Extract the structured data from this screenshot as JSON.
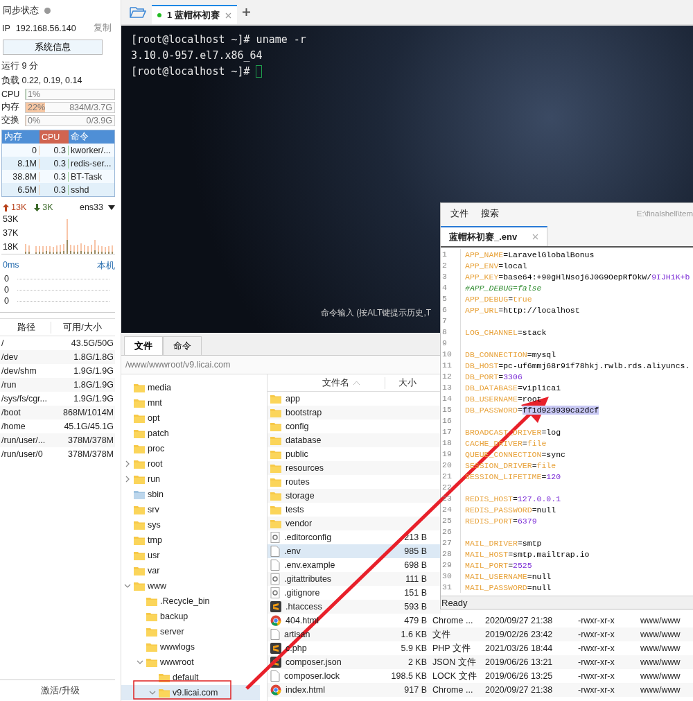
{
  "sidebar": {
    "sync_label": "同步状态",
    "ip_label": "IP",
    "ip": "192.168.56.140",
    "copy_link": "复制",
    "sysinfo_button": "系统信息",
    "uptime": "运行 9 分",
    "load": "负载 0.22, 0.19, 0.14",
    "meters": [
      {
        "label": "CPU",
        "percent": "1%",
        "level": 0.01
      },
      {
        "label": "内存",
        "percent": "22%",
        "detail": "834M/3.7G",
        "level": 0.22
      },
      {
        "label": "交换",
        "percent": "0%",
        "detail": "0/3.9G",
        "level": 0
      }
    ],
    "process_table": {
      "columns": [
        "内存",
        "CPU",
        "命令"
      ],
      "rows": [
        [
          "0",
          "0.3",
          "kworker/..."
        ],
        [
          "8.1M",
          "0.3",
          "redis-ser..."
        ],
        [
          "38.8M",
          "0.3",
          "BT-Task"
        ],
        [
          "6.5M",
          "0.3",
          "sshd"
        ]
      ]
    },
    "network": {
      "up": "13K",
      "down": "3K",
      "interface": "ens33",
      "ticks": [
        "53K",
        "37K",
        "18K"
      ]
    },
    "latency": {
      "reading": "0ms",
      "host": "本机",
      "ticks": [
        "0",
        "0",
        "0"
      ]
    },
    "disk_table": {
      "columns": [
        "路径",
        "可用/大小"
      ],
      "rows": [
        [
          "/",
          "43.5G/50G"
        ],
        [
          "/dev",
          "1.8G/1.8G"
        ],
        [
          "/dev/shm",
          "1.9G/1.9G"
        ],
        [
          "/run",
          "1.8G/1.9G"
        ],
        [
          "/sys/fs/cgr...",
          "1.9G/1.9G"
        ],
        [
          "/boot",
          "868M/1014M"
        ],
        [
          "/home",
          "45.1G/45.1G"
        ],
        [
          "/run/user/...",
          "378M/378M"
        ],
        [
          "/run/user/0",
          "378M/378M"
        ]
      ]
    },
    "upgrade_link": "激活/升级"
  },
  "session_tabs": [
    {
      "number": "1",
      "title": "蓝帽杯初赛",
      "selected": true,
      "connected": true
    }
  ],
  "terminal": {
    "lines": [
      "[root@localhost ~]# uname -r",
      "3.10.0-957.el7.x86_64",
      "[root@localhost ~]#"
    ],
    "input_hint": "命令输入 (按ALT键提示历史,T"
  },
  "bottom_tabs": [
    {
      "label": "文件",
      "selected": true
    },
    {
      "label": "命令",
      "selected": false
    }
  ],
  "path": "/www/wwwroot/v9.licai.com",
  "tree": [
    {
      "label": "media",
      "kind": "folder",
      "selected": false
    },
    {
      "label": "mnt",
      "kind": "folder",
      "selected": false
    },
    {
      "label": "opt",
      "kind": "folder",
      "selected": false
    },
    {
      "label": "patch",
      "kind": "folder",
      "selected": false
    },
    {
      "label": "proc",
      "kind": "folder",
      "selected": false
    },
    {
      "label": "root",
      "kind": "folder",
      "expanded": false,
      "selected": false
    },
    {
      "label": "run",
      "kind": "folder",
      "expanded": false,
      "selected": false
    },
    {
      "label": "sbin",
      "kind": "link",
      "selected": false
    },
    {
      "label": "srv",
      "kind": "folder",
      "selected": false
    },
    {
      "label": "sys",
      "kind": "folder",
      "selected": false
    },
    {
      "label": "tmp",
      "kind": "folder",
      "selected": false
    },
    {
      "label": "usr",
      "kind": "folder",
      "selected": false
    },
    {
      "label": "var",
      "kind": "folder",
      "selected": false
    },
    {
      "label": "www",
      "kind": "folder",
      "expanded": true,
      "selected": false,
      "children": [
        {
          "label": ".Recycle_bin",
          "kind": "folder",
          "selected": false
        },
        {
          "label": "backup",
          "kind": "folder",
          "selected": false
        },
        {
          "label": "server",
          "kind": "folder",
          "selected": false
        },
        {
          "label": "wwwlogs",
          "kind": "folder",
          "selected": false
        },
        {
          "label": "wwwroot",
          "kind": "folder",
          "expanded": true,
          "selected": false,
          "children": [
            {
              "label": "default",
              "kind": "folder",
              "selected": false
            },
            {
              "label": "v9.licai.com",
              "kind": "folder",
              "expanded": true,
              "selected": true
            }
          ]
        }
      ]
    }
  ],
  "file_table": {
    "columns": [
      "文件名",
      "大小"
    ],
    "rows": [
      {
        "name": "app",
        "kind": "folder",
        "selected": false
      },
      {
        "name": "bootstrap",
        "kind": "folder",
        "selected": false
      },
      {
        "name": "config",
        "kind": "folder",
        "selected": false
      },
      {
        "name": "database",
        "kind": "folder",
        "selected": false
      },
      {
        "name": "public",
        "kind": "folder",
        "selected": false
      },
      {
        "name": "resources",
        "kind": "folder",
        "selected": false
      },
      {
        "name": "routes",
        "kind": "folder",
        "selected": false
      },
      {
        "name": "storage",
        "kind": "folder",
        "selected": false
      },
      {
        "name": "tests",
        "kind": "folder",
        "selected": false
      },
      {
        "name": "vendor",
        "kind": "folder",
        "selected": false
      },
      {
        "name": ".editorconfig",
        "kind": "config",
        "size": "213 B",
        "selected": false
      },
      {
        "name": ".env",
        "kind": "file",
        "size": "985 B",
        "selected": true
      },
      {
        "name": ".env.example",
        "kind": "file",
        "size": "698 B",
        "selected": false
      },
      {
        "name": ".gitattributes",
        "kind": "config",
        "size": "111 B",
        "selected": false
      },
      {
        "name": ".gitignore",
        "kind": "config",
        "size": "151 B",
        "selected": false
      },
      {
        "name": ".htaccess",
        "kind": "sublime",
        "size": "593 B",
        "selected": false
      },
      {
        "name": "404.html",
        "kind": "chrome",
        "size": "479 B",
        "type": "Chrome ...",
        "date": "2020/09/27 21:38",
        "perm": "-rwxr-xr-x",
        "owner": "www/www",
        "selected": false
      },
      {
        "name": "artisan",
        "kind": "file",
        "size": "1.6 KB",
        "type": "文件",
        "date": "2019/02/26 23:42",
        "perm": "-rwxr-xr-x",
        "owner": "www/www",
        "selected": false
      },
      {
        "name": "c.php",
        "kind": "sublime",
        "size": "5.9 KB",
        "type": "PHP 文件",
        "date": "2021/03/26 18:44",
        "perm": "-rwxr-xr-x",
        "owner": "www/www",
        "selected": false
      },
      {
        "name": "composer.json",
        "kind": "sublime",
        "size": "2 KB",
        "type": "JSON 文件",
        "date": "2019/06/26 13:21",
        "perm": "-rwxr-xr-x",
        "owner": "www/www",
        "selected": false
      },
      {
        "name": "composer.lock",
        "kind": "file",
        "size": "198.5 KB",
        "type": "LOCK 文件",
        "date": "2019/06/26 13:25",
        "perm": "-rwxr-xr-x",
        "owner": "www/www",
        "selected": false
      },
      {
        "name": "index.html",
        "kind": "chrome",
        "size": "917 B",
        "type": "Chrome ...",
        "date": "2020/09/27 21:38",
        "perm": "-rwxr-xr-x",
        "owner": "www/www",
        "selected": false
      }
    ]
  },
  "editor": {
    "menus": [
      "文件",
      "搜索"
    ],
    "file_path": "E:\\finalshell\\tem",
    "tab": {
      "title": "蓝帽杯初赛_.env",
      "selected": true
    },
    "status": "Ready",
    "lines": [
      {
        "n": "1",
        "kind": "pair",
        "key": "APP_NAME",
        "sep": "=",
        "value": [
          {
            "t": "LaravelGlobalBonus",
            "kind": "plain"
          }
        ]
      },
      {
        "n": "2",
        "kind": "pair",
        "key": "APP_ENV",
        "sep": "=",
        "value": [
          {
            "t": "local",
            "kind": "plain"
          }
        ]
      },
      {
        "n": "3",
        "kind": "pair",
        "key": "APP_KEY",
        "sep": "=",
        "value": [
          {
            "t": "base64:+90gHlNsoj6J0G9OepRfOkW/",
            "kind": "plain"
          },
          {
            "t": "9IJHiK+b",
            "kind": "number"
          }
        ]
      },
      {
        "n": "4",
        "kind": "comment",
        "text": "#APP_DEBUG=false"
      },
      {
        "n": "5",
        "kind": "pair",
        "key": "APP_DEBUG",
        "sep": "=",
        "value": [
          {
            "t": "true",
            "kind": "keyword"
          }
        ]
      },
      {
        "n": "6",
        "kind": "pair",
        "key": "APP_URL",
        "sep": "=",
        "value": [
          {
            "t": "http://localhost",
            "kind": "plain"
          }
        ]
      },
      {
        "n": "7",
        "kind": "blank"
      },
      {
        "n": "8",
        "kind": "pair",
        "key": "LOG_CHANNEL",
        "sep": "=",
        "value": [
          {
            "t": "stack",
            "kind": "plain"
          }
        ]
      },
      {
        "n": "9",
        "kind": "blank"
      },
      {
        "n": "10",
        "kind": "pair",
        "key": "DB_CONNECTION",
        "sep": "=",
        "value": [
          {
            "t": "mysql",
            "kind": "plain"
          }
        ]
      },
      {
        "n": "11",
        "kind": "pair",
        "key": "DB_HOST",
        "sep": "=",
        "value": [
          {
            "t": "pc-uf6mmj68r91f78hkj.rwlb.rds.aliyuncs.",
            "kind": "plain"
          }
        ]
      },
      {
        "n": "12",
        "kind": "pair",
        "key": "DB_PORT",
        "sep": "=",
        "value": [
          {
            "t": "3306",
            "kind": "number"
          }
        ]
      },
      {
        "n": "13",
        "kind": "pair",
        "key": "DB_DATABASE",
        "sep": "=",
        "value": [
          {
            "t": "viplicai",
            "kind": "plain"
          }
        ]
      },
      {
        "n": "14",
        "kind": "pair",
        "key": "DB_USERNAME",
        "sep": "=",
        "value": [
          {
            "t": "root",
            "kind": "plain"
          }
        ]
      },
      {
        "n": "15",
        "kind": "pair",
        "key": "DB_PASSWORD",
        "sep": "=",
        "value": [
          {
            "t": "ff1d923939ca2dcf",
            "kind": "selected"
          }
        ]
      },
      {
        "n": "16",
        "kind": "blank"
      },
      {
        "n": "17",
        "kind": "pair",
        "key": "BROADCAST_DRIVER",
        "sep": "=",
        "value": [
          {
            "t": "log",
            "kind": "plain"
          }
        ]
      },
      {
        "n": "18",
        "kind": "pair",
        "key": "CACHE_DRIVER",
        "sep": "=",
        "value": [
          {
            "t": "file",
            "kind": "keyword"
          }
        ]
      },
      {
        "n": "19",
        "kind": "pair",
        "key": "QUEUE_CONNECTION",
        "sep": "=",
        "value": [
          {
            "t": "sync",
            "kind": "plain"
          }
        ]
      },
      {
        "n": "20",
        "kind": "pair",
        "key": "SESSION_DRIVER",
        "sep": "=",
        "value": [
          {
            "t": "file",
            "kind": "keyword"
          }
        ]
      },
      {
        "n": "21",
        "kind": "pair",
        "key": "SESSION_LIFETIME",
        "sep": "=",
        "value": [
          {
            "t": "120",
            "kind": "number"
          }
        ]
      },
      {
        "n": "22",
        "kind": "blank"
      },
      {
        "n": "23",
        "kind": "pair",
        "key": "REDIS_HOST",
        "sep": "=",
        "value": [
          {
            "t": "127.0.0.1",
            "kind": "number"
          }
        ]
      },
      {
        "n": "24",
        "kind": "pair",
        "key": "REDIS_PASSWORD",
        "sep": "=",
        "value": [
          {
            "t": "null",
            "kind": "plain"
          }
        ]
      },
      {
        "n": "25",
        "kind": "pair",
        "key": "REDIS_PORT",
        "sep": "=",
        "value": [
          {
            "t": "6379",
            "kind": "number"
          }
        ]
      },
      {
        "n": "26",
        "kind": "blank"
      },
      {
        "n": "27",
        "kind": "pair",
        "key": "MAIL_DRIVER",
        "sep": "=",
        "value": [
          {
            "t": "smtp",
            "kind": "plain"
          }
        ]
      },
      {
        "n": "28",
        "kind": "pair",
        "key": "MAIL_HOST",
        "sep": "=",
        "value": [
          {
            "t": "smtp.mailtrap.io",
            "kind": "plain"
          }
        ]
      },
      {
        "n": "29",
        "kind": "pair",
        "key": "MAIL_PORT",
        "sep": "=",
        "value": [
          {
            "t": "2525",
            "kind": "number"
          }
        ]
      },
      {
        "n": "30",
        "kind": "pair",
        "key": "MAIL_USERNAME",
        "sep": "=",
        "value": [
          {
            "t": "null",
            "kind": "plain"
          }
        ]
      },
      {
        "n": "31",
        "kind": "pair",
        "key": "MAIL_PASSWORD",
        "sep": "=",
        "value": [
          {
            "t": "null",
            "kind": "plain"
          }
        ]
      }
    ]
  }
}
